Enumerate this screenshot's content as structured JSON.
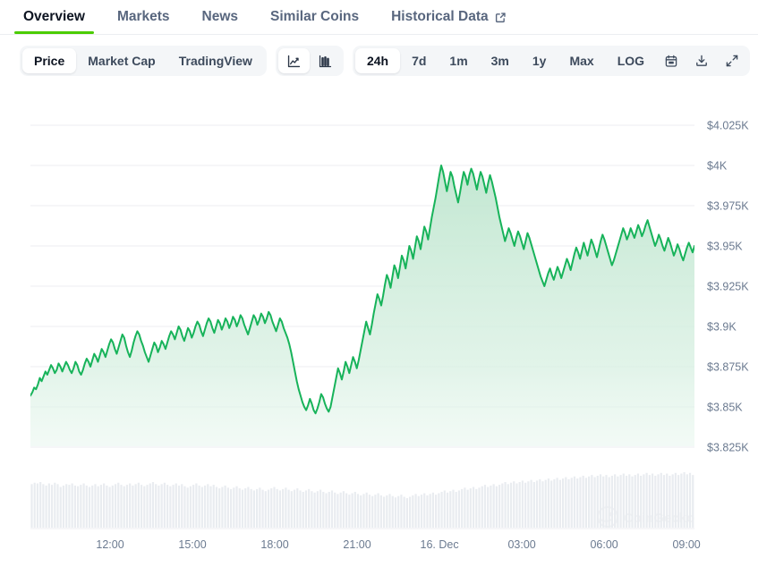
{
  "theme": {
    "accent_green": "#4bcc00",
    "line_green": "#17b35a",
    "area_green": "#cdeddb",
    "grid": "#eceef1",
    "text_muted": "#58667e",
    "text_dark": "#0d1421",
    "nav_bar": "#e9ecf0",
    "toolbar_bg": "#f4f6f8"
  },
  "tabs": [
    {
      "label": "Overview",
      "active": true,
      "external": false
    },
    {
      "label": "Markets",
      "active": false,
      "external": false
    },
    {
      "label": "News",
      "active": false,
      "external": false
    },
    {
      "label": "Similar Coins",
      "active": false,
      "external": false
    },
    {
      "label": "Historical Data",
      "active": false,
      "external": true
    }
  ],
  "toolbar": {
    "metric_group": [
      {
        "label": "Price",
        "active": true
      },
      {
        "label": "Market Cap",
        "active": false
      },
      {
        "label": "TradingView",
        "active": false
      }
    ],
    "chart_type_group": [
      {
        "icon": "line-chart-icon",
        "label": "Line chart",
        "active": true
      },
      {
        "icon": "candlestick-chart-icon",
        "label": "Candlestick chart",
        "active": false
      }
    ],
    "range_group": [
      {
        "label": "24h",
        "active": true
      },
      {
        "label": "7d",
        "active": false
      },
      {
        "label": "1m",
        "active": false
      },
      {
        "label": "3m",
        "active": false
      },
      {
        "label": "1y",
        "active": false
      },
      {
        "label": "Max",
        "active": false
      },
      {
        "label": "LOG",
        "active": false
      }
    ],
    "range_icons": [
      {
        "icon": "calendar-icon",
        "label": "Select date range"
      },
      {
        "icon": "download-icon",
        "label": "Download chart"
      },
      {
        "icon": "expand-icon",
        "label": "Fullscreen"
      }
    ]
  },
  "watermark": {
    "label": "CoinGecko"
  },
  "chart_data": {
    "type": "area",
    "title": "",
    "xlabel": "",
    "ylabel": "",
    "grid": true,
    "legend": false,
    "ylim": [
      3825,
      4025
    ],
    "ytick_labels": [
      "$4.025K",
      "$4K",
      "$3.975K",
      "$3.95K",
      "$3.925K",
      "$3.9K",
      "$3.875K",
      "$3.85K",
      "$3.825K"
    ],
    "ytick_values": [
      4025,
      4000,
      3975,
      3950,
      3925,
      3900,
      3875,
      3850,
      3825
    ],
    "xtick_labels": [
      "12:00",
      "15:00",
      "18:00",
      "21:00",
      "16. Dec",
      "03:00",
      "06:00",
      "09:00"
    ],
    "xtick_positions": [
      0.12,
      0.244,
      0.368,
      0.492,
      0.616,
      0.74,
      0.864,
      0.988
    ],
    "series": [
      {
        "name": "Price (USD)",
        "unit": "USD",
        "values": [
          3857,
          3859,
          3862,
          3861,
          3864,
          3868,
          3866,
          3869,
          3872,
          3870,
          3873,
          3876,
          3874,
          3871,
          3873,
          3877,
          3875,
          3872,
          3875,
          3878,
          3876,
          3873,
          3871,
          3874,
          3878,
          3876,
          3872,
          3870,
          3873,
          3877,
          3880,
          3878,
          3875,
          3879,
          3883,
          3881,
          3878,
          3882,
          3886,
          3884,
          3881,
          3885,
          3889,
          3892,
          3890,
          3886,
          3883,
          3887,
          3891,
          3895,
          3893,
          3888,
          3884,
          3881,
          3885,
          3890,
          3894,
          3897,
          3895,
          3891,
          3888,
          3884,
          3881,
          3878,
          3882,
          3886,
          3890,
          3888,
          3884,
          3887,
          3891,
          3889,
          3886,
          3890,
          3894,
          3897,
          3895,
          3892,
          3896,
          3900,
          3898,
          3894,
          3891,
          3895,
          3899,
          3897,
          3893,
          3896,
          3900,
          3903,
          3901,
          3897,
          3894,
          3898,
          3902,
          3905,
          3903,
          3899,
          3896,
          3900,
          3904,
          3902,
          3898,
          3901,
          3905,
          3903,
          3899,
          3902,
          3906,
          3904,
          3900,
          3903,
          3907,
          3905,
          3901,
          3898,
          3895,
          3899,
          3903,
          3907,
          3905,
          3901,
          3904,
          3908,
          3906,
          3902,
          3905,
          3909,
          3907,
          3903,
          3900,
          3897,
          3901,
          3905,
          3903,
          3899,
          3896,
          3893,
          3889,
          3884,
          3878,
          3872,
          3866,
          3861,
          3857,
          3853,
          3850,
          3848,
          3851,
          3855,
          3852,
          3848,
          3846,
          3849,
          3853,
          3858,
          3856,
          3852,
          3849,
          3847,
          3850,
          3856,
          3862,
          3868,
          3874,
          3871,
          3867,
          3872,
          3878,
          3875,
          3871,
          3876,
          3881,
          3878,
          3874,
          3879,
          3885,
          3891,
          3897,
          3903,
          3899,
          3895,
          3901,
          3908,
          3914,
          3920,
          3917,
          3913,
          3919,
          3926,
          3932,
          3929,
          3924,
          3931,
          3938,
          3935,
          3930,
          3937,
          3944,
          3941,
          3936,
          3943,
          3950,
          3947,
          3942,
          3949,
          3956,
          3953,
          3948,
          3955,
          3962,
          3959,
          3954,
          3961,
          3968,
          3974,
          3980,
          3987,
          3994,
          4000,
          3996,
          3990,
          3984,
          3990,
          3996,
          3993,
          3987,
          3982,
          3977,
          3983,
          3990,
          3996,
          3993,
          3988,
          3994,
          3998,
          3995,
          3990,
          3985,
          3991,
          3996,
          3993,
          3988,
          3983,
          3989,
          3994,
          3990,
          3985,
          3980,
          3974,
          3968,
          3963,
          3958,
          3953,
          3957,
          3961,
          3958,
          3954,
          3950,
          3955,
          3959,
          3956,
          3952,
          3948,
          3953,
          3958,
          3955,
          3951,
          3947,
          3943,
          3939,
          3935,
          3931,
          3928,
          3925,
          3929,
          3933,
          3936,
          3932,
          3929,
          3933,
          3937,
          3934,
          3930,
          3934,
          3938,
          3942,
          3939,
          3935,
          3940,
          3945,
          3949,
          3946,
          3942,
          3947,
          3952,
          3948,
          3944,
          3949,
          3954,
          3951,
          3947,
          3943,
          3948,
          3953,
          3957,
          3954,
          3950,
          3946,
          3942,
          3938,
          3941,
          3945,
          3949,
          3953,
          3957,
          3961,
          3958,
          3954,
          3957,
          3961,
          3958,
          3955,
          3959,
          3963,
          3960,
          3956,
          3959,
          3963,
          3966,
          3962,
          3958,
          3954,
          3950,
          3953,
          3957,
          3954,
          3950,
          3947,
          3951,
          3955,
          3952,
          3948,
          3944,
          3947,
          3951,
          3948,
          3944,
          3941,
          3945,
          3949,
          3952,
          3949,
          3946,
          3950
        ]
      }
    ],
    "navigator": {
      "type": "bar",
      "name": "Volume navigator",
      "values": [
        62,
        64,
        63,
        65,
        62,
        60,
        63,
        61,
        64,
        62,
        58,
        60,
        62,
        61,
        63,
        60,
        59,
        61,
        63,
        60,
        58,
        60,
        62,
        59,
        61,
        63,
        60,
        58,
        60,
        62,
        64,
        61,
        59,
        61,
        63,
        60,
        62,
        64,
        61,
        59,
        61,
        63,
        65,
        62,
        60,
        62,
        64,
        61,
        59,
        61,
        63,
        60,
        62,
        59,
        57,
        59,
        61,
        63,
        60,
        58,
        60,
        62,
        59,
        61,
        58,
        56,
        58,
        60,
        57,
        55,
        57,
        59,
        56,
        54,
        56,
        58,
        55,
        53,
        55,
        57,
        54,
        52,
        54,
        56,
        58,
        55,
        53,
        55,
        57,
        54,
        52,
        54,
        56,
        53,
        51,
        53,
        55,
        52,
        50,
        52,
        54,
        51,
        49,
        51,
        53,
        50,
        48,
        50,
        52,
        49,
        47,
        49,
        51,
        48,
        46,
        48,
        50,
        47,
        45,
        47,
        49,
        46,
        44,
        46,
        48,
        45,
        43,
        45,
        47,
        44,
        42,
        44,
        46,
        48,
        45,
        47,
        49,
        46,
        48,
        50,
        47,
        49,
        51,
        53,
        50,
        52,
        54,
        51,
        53,
        55,
        57,
        54,
        56,
        58,
        55,
        57,
        59,
        61,
        58,
        60,
        62,
        59,
        61,
        63,
        65,
        62,
        64,
        66,
        63,
        65,
        67,
        64,
        66,
        68,
        65,
        67,
        69,
        66,
        68,
        70,
        67,
        69,
        71,
        68,
        70,
        72,
        69,
        71,
        73,
        70,
        72,
        74,
        71,
        73,
        75,
        72,
        74,
        76,
        73,
        75,
        72,
        74,
        76,
        73,
        75,
        77,
        74,
        76,
        73,
        75,
        77,
        74,
        76,
        78,
        75,
        77,
        74,
        76,
        78,
        75,
        77,
        74,
        76,
        78,
        75,
        77,
        79,
        76,
        78,
        75
      ]
    }
  }
}
